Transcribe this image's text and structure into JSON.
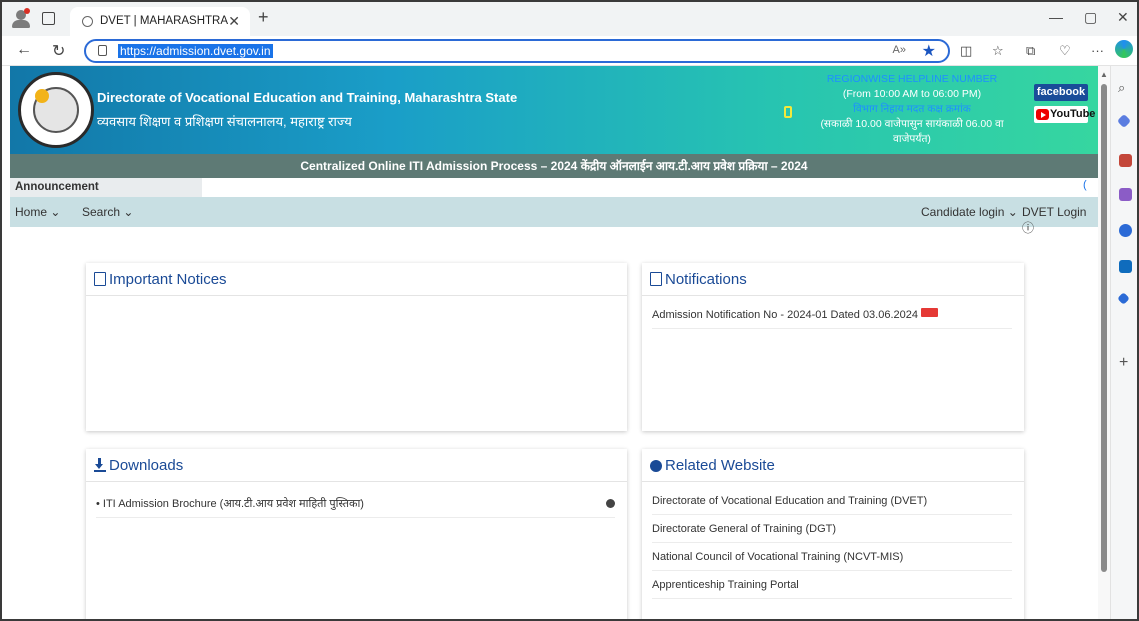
{
  "browser": {
    "tab_title": "DVET | MAHARASHTRA",
    "url": "https://admission.dvet.gov.in",
    "read_aloud": "A»"
  },
  "header": {
    "org_en": "Directorate of Vocational Education and Training, Maharashtra State",
    "org_mr": "व्यवसाय शिक्षण व प्रशिक्षण संचालनालय, महाराष्ट्र राज्य",
    "helpline_title": "REGIONWISE HELPLINE NUMBER",
    "helpline_hours": "(From 10:00 AM to 06:00 PM)",
    "helpline_title_mr": "विभाग निहाय मदत कक्ष क्रमांक",
    "helpline_hours_mr": "(सकाळी 10.00 वाजेपासुन सायंकाळी 06.00 वा वाजेपर्यंत)",
    "facebook": "facebook",
    "youtube": "YouTube"
  },
  "process_title": "Centralized Online ITI Admission Process – 2024   केंद्रीय ऑनलाईन आय.टी.आय प्रवेश प्रक्रिया – 2024",
  "announcement": {
    "label": "Announcement",
    "marquee": "("
  },
  "menu": {
    "home": "Home ⌄",
    "search": "Search ⌄",
    "candidate_login": "Candidate login ⌄",
    "dvet_login": "DVET Login ⓘ"
  },
  "panels": {
    "notices": {
      "title": "Important Notices"
    },
    "notifications": {
      "title": "Notifications",
      "items": [
        "Admission Notification No - 2024-01 Dated 03.06.2024"
      ]
    },
    "downloads": {
      "title": "Downloads",
      "items": [
        "• ITI Admission Brochure (आय.टी.आय प्रवेश माहिती पुस्तिका)"
      ]
    },
    "related": {
      "title": "Related Website",
      "items": [
        "Directorate of Vocational Education and Training (DVET)",
        "Directorate General of Training (DGT)",
        "National Council of Vocational Training (NCVT-MIS)",
        "Apprenticeship Training Portal"
      ]
    }
  },
  "colors": {
    "banner_start": "#1277a8",
    "banner_end": "#36d6a0",
    "process_bar": "#5e7a75",
    "menubar": "#c8dfe3",
    "panel_title": "#1a4a96"
  }
}
